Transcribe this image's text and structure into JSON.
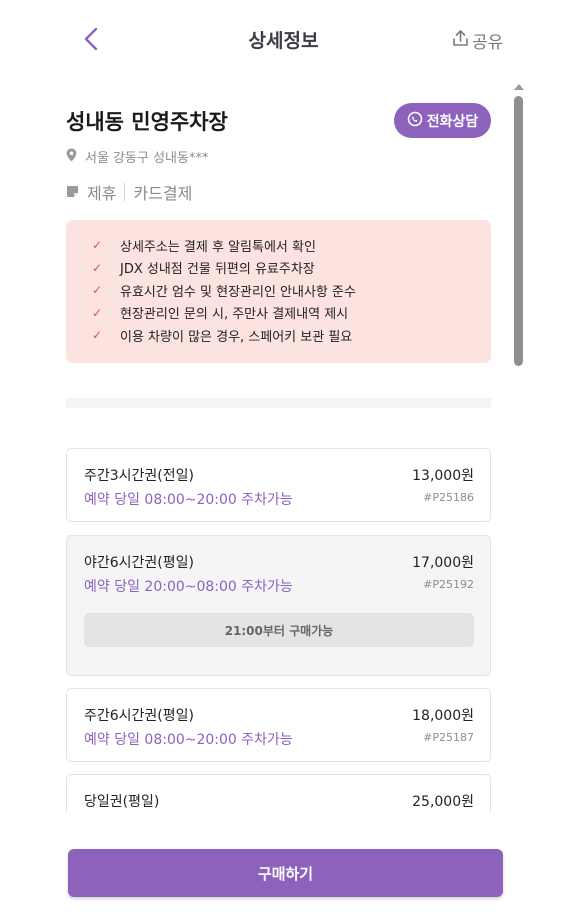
{
  "header": {
    "title": "상세정보",
    "share_label": "공유"
  },
  "lot": {
    "name": "성내동 민영주차장",
    "call_label": "전화상담",
    "address": "서울 강동구 성내동***",
    "tags": [
      "제휴",
      "카드결제"
    ]
  },
  "notice": {
    "items": [
      "상세주소는 결제 후 알림톡에서 확인",
      "JDX 성내점 건물 뒤편의 유료주차장",
      "유효시간 엄수 및 현장관리인 안내사항 준수",
      "현장관리인 문의 시, 주만사 결제내역 제시",
      "이용 차량이 많은 경우, 스페어키 보관 필요"
    ]
  },
  "tickets": [
    {
      "name": "주간3시간권(전일)",
      "price": "13,000원",
      "availability": "예약 당일 08:00~20:00 주차가능",
      "code": "#P25186"
    },
    {
      "name": "야간6시간권(평일)",
      "price": "17,000원",
      "availability": "예약 당일 20:00~08:00 주차가능",
      "code": "#P25192",
      "note": "21:00부터 구매가능"
    },
    {
      "name": "주간6시간권(평일)",
      "price": "18,000원",
      "availability": "예약 당일 08:00~20:00 주차가능",
      "code": "#P25187"
    },
    {
      "name": "당일권(평일)",
      "price": "25,000원"
    }
  ],
  "buy_label": "구매하기",
  "colors": {
    "accent": "#8c62bd",
    "notice_bg": "#fde3df",
    "check": "#d9534f"
  }
}
